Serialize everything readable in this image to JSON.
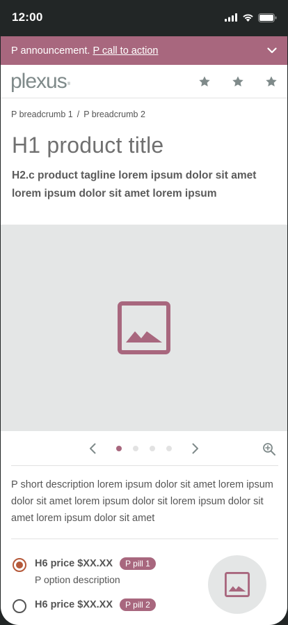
{
  "status_bar": {
    "time": "12:00"
  },
  "announcement": {
    "text": "P announcement.",
    "cta": "P call  to action"
  },
  "header": {
    "logo": "plexus",
    "logo_mark": "®"
  },
  "breadcrumbs": [
    "P breadcrumb 1",
    "P breadcrumb 2"
  ],
  "breadcrumb_separator": "/",
  "product": {
    "title": "H1 product title",
    "tagline": "H2.c product tagline lorem ipsum dolor sit amet lorem ipsum dolor sit amet lorem ipsum",
    "short_description": "P short description lorem ipsum dolor sit amet lorem ipsum dolor sit amet lorem ipsum dolor sit lorem ipsum dolor sit amet lorem ipsum dolor sit amet"
  },
  "carousel": {
    "total": 4,
    "active": 1
  },
  "options": [
    {
      "price": "H6 price $XX.XX",
      "pill": "P pill 1",
      "description": "P option description",
      "selected": true
    },
    {
      "price": "H6 price $XX.XX",
      "pill": "P pill 2",
      "description": "",
      "selected": false
    }
  ],
  "colors": {
    "brand": "#a8677e",
    "selected_radio": "#b5593a",
    "placeholder_bg": "#e4e6e6",
    "icon_gray": "#7f8a8a"
  },
  "icons": [
    "signal-icon",
    "wifi-icon",
    "battery-icon",
    "chevron-down-icon",
    "star-icon",
    "image-placeholder-icon",
    "chevron-left-icon",
    "chevron-right-icon",
    "zoom-icon"
  ]
}
